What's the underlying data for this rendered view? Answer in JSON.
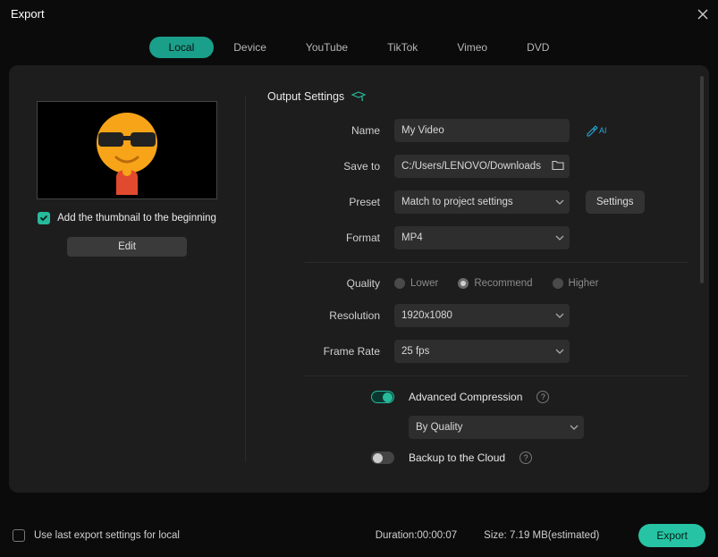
{
  "window": {
    "title": "Export"
  },
  "tabs": {
    "local": "Local",
    "device": "Device",
    "youtube": "YouTube",
    "tiktok": "TikTok",
    "vimeo": "Vimeo",
    "dvd": "DVD"
  },
  "thumbnail": {
    "checkbox_label": "Add the thumbnail to the beginning",
    "edit_button": "Edit"
  },
  "output": {
    "section_title": "Output Settings",
    "labels": {
      "name": "Name",
      "save_to": "Save to",
      "preset": "Preset",
      "format": "Format",
      "quality": "Quality",
      "resolution": "Resolution",
      "frame_rate": "Frame Rate"
    },
    "name_value": "My Video",
    "save_to_value": "C:/Users/LENOVO/Downloads",
    "preset_value": "Match to project settings",
    "preset_settings_button": "Settings",
    "format_value": "MP4",
    "quality": {
      "lower": "Lower",
      "recommend": "Recommend",
      "higher": "Higher"
    },
    "resolution_value": "1920x1080",
    "frame_rate_value": "25 fps"
  },
  "advanced": {
    "compression_label": "Advanced Compression",
    "compression_mode": "By Quality",
    "backup_label": "Backup to the Cloud"
  },
  "footer": {
    "use_last_label": "Use last export settings for local",
    "duration_label": "Duration:",
    "duration_value": "00:00:07",
    "size_label": "Size:",
    "size_value": "7.19 MB",
    "size_suffix": "(estimated)",
    "export_button": "Export"
  },
  "ai_suffix": "AI"
}
